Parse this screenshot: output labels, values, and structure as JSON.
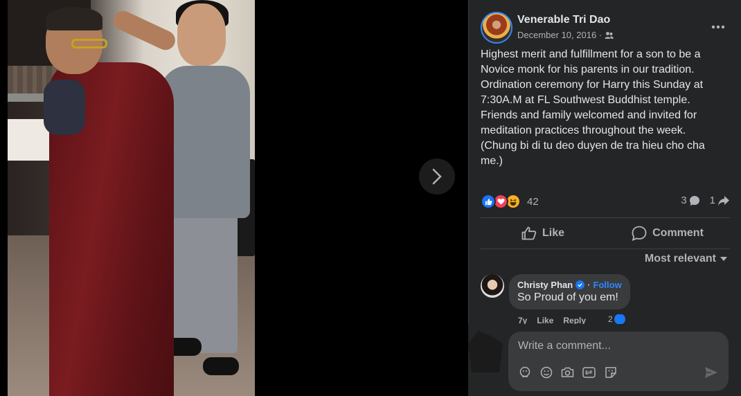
{
  "post": {
    "author": "Venerable Tri Dao",
    "date": "December 10, 2016 ·",
    "text": "Highest merit and fulfillment for a son to be a\nNovice monk for his parents in our tradition.\nOrdination ceremony for Harry this Sunday at\n7:30A.M at FL Southwest Buddhist temple.\nFriends and family welcomed and invited for\nmeditation practices throughout the week.\n(Chung bi di tu deo duyen de tra hieu cho cha\nme.)"
  },
  "reactions": {
    "count": "42",
    "types": [
      "like",
      "love",
      "haha"
    ],
    "comments_count": "3",
    "shares_count": "1"
  },
  "actions": {
    "like_label": "Like",
    "comment_label": "Comment"
  },
  "comments": {
    "sort_label": "Most relevant",
    "items": [
      {
        "name": "Christy Phan",
        "follow_label": "Follow",
        "text": "So Proud of you em!",
        "time": "7y",
        "like_label": "Like",
        "reply_label": "Reply",
        "reaction_count": "2"
      }
    ]
  },
  "composer": {
    "placeholder": "Write a comment..."
  },
  "icons": {
    "next": "chevron-right-icon",
    "more": "more-options-icon",
    "audience": "friends-icon",
    "sticker": "sticker-icon",
    "emoji": "emoji-icon",
    "camera": "camera-icon",
    "gif": "gif-icon",
    "avatar": "avatar-sticker-icon",
    "send": "send-icon"
  },
  "colors": {
    "panel_bg": "#242526",
    "bubble_bg": "#3a3b3c",
    "text_primary": "#e4e6eb",
    "text_secondary": "#b0b3b8",
    "accent": "#2d88ff",
    "like_blue": "#1877f2",
    "love_red": "#f33e58",
    "haha_yellow": "#f7b125"
  }
}
